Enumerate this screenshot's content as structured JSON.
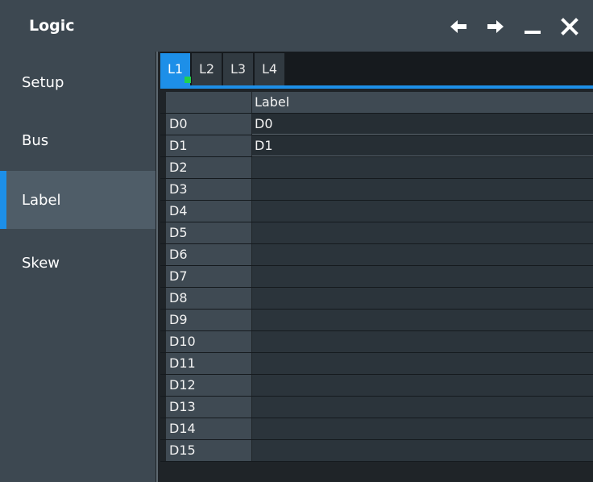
{
  "window": {
    "title": "Logic",
    "buttons": [
      {
        "name": "back",
        "icon": "arrow-left-icon"
      },
      {
        "name": "forward",
        "icon": "arrow-right-icon"
      },
      {
        "name": "minimize",
        "icon": "minimize-icon"
      },
      {
        "name": "close",
        "icon": "close-icon"
      }
    ]
  },
  "sidebar": {
    "items": [
      {
        "label": "Setup",
        "active": false
      },
      {
        "label": "Bus",
        "active": false
      },
      {
        "label": "Label",
        "active": true
      },
      {
        "label": "Skew",
        "active": false
      }
    ]
  },
  "tabs": [
    {
      "label": "L1",
      "active": true,
      "indicator_color": "#21d24e"
    },
    {
      "label": "L2",
      "active": false
    },
    {
      "label": "L3",
      "active": false
    },
    {
      "label": "L4",
      "active": false
    }
  ],
  "table": {
    "column_header": "Label",
    "rows": [
      {
        "channel": "D0",
        "label": "D0"
      },
      {
        "channel": "D1",
        "label": "D1"
      },
      {
        "channel": "D2",
        "label": ""
      },
      {
        "channel": "D3",
        "label": ""
      },
      {
        "channel": "D4",
        "label": ""
      },
      {
        "channel": "D5",
        "label": ""
      },
      {
        "channel": "D6",
        "label": ""
      },
      {
        "channel": "D7",
        "label": ""
      },
      {
        "channel": "D8",
        "label": ""
      },
      {
        "channel": "D9",
        "label": ""
      },
      {
        "channel": "D10",
        "label": ""
      },
      {
        "channel": "D11",
        "label": ""
      },
      {
        "channel": "D12",
        "label": ""
      },
      {
        "channel": "D13",
        "label": ""
      },
      {
        "channel": "D14",
        "label": ""
      },
      {
        "channel": "D15",
        "label": ""
      }
    ]
  },
  "colors": {
    "accent": "#1d8fe8",
    "panel": "#3d4851",
    "background": "#202428",
    "indicator": "#21d24e"
  }
}
